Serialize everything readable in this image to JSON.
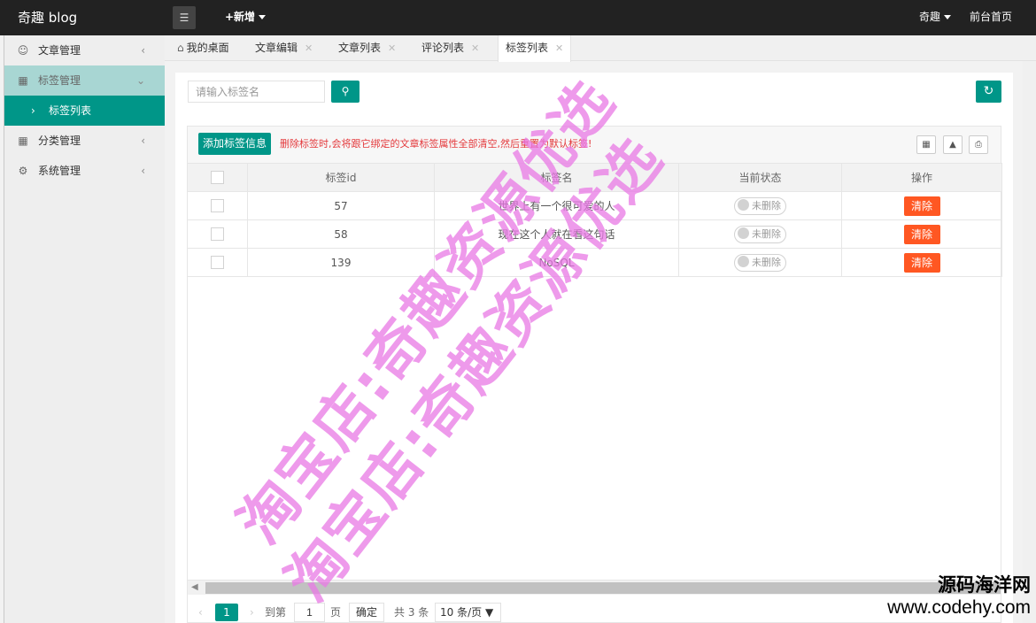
{
  "topbar": {
    "logo": "奇趣 blog",
    "menu_icon": "hamburger-icon",
    "add_new": "+新增",
    "user": "奇趣",
    "front_home": "前台首页"
  },
  "sidebar": {
    "items": [
      {
        "label": "文章管理",
        "icon": "user-icon"
      },
      {
        "label": "标签管理",
        "icon": "tag-icon"
      },
      {
        "label": "标签列表",
        "icon": "chevron-right-icon"
      },
      {
        "label": "分类管理",
        "icon": "folder-icon"
      },
      {
        "label": "系统管理",
        "icon": "settings-icon"
      }
    ]
  },
  "tabs": [
    {
      "label": "我的桌面"
    },
    {
      "label": "文章编辑"
    },
    {
      "label": "文章列表"
    },
    {
      "label": "评论列表"
    },
    {
      "label": "标签列表"
    }
  ],
  "search": {
    "placeholder": "请输入标签名"
  },
  "toolbar": {
    "add_label": "添加标签信息",
    "warning": "删除标签时,会将跟它绑定的文章标签属性全部清空,然后重置为默认标签!"
  },
  "table": {
    "headers": [
      "标签id",
      "标签名",
      "当前状态",
      "操作"
    ],
    "rows": [
      {
        "id": "57",
        "name": "世界上有一个很可爱的人",
        "status": "未删除",
        "action": "清除"
      },
      {
        "id": "58",
        "name": "现在这个人就在看这句话",
        "status": "未删除",
        "action": "清除"
      },
      {
        "id": "139",
        "name": "NoSQL",
        "status": "未删除",
        "action": "清除"
      }
    ]
  },
  "pager": {
    "current_page": "1",
    "goto_label": "到第",
    "page_input": "1",
    "page_unit": "页",
    "confirm": "确定",
    "total": "共 3 条",
    "page_size": "10 条/页"
  },
  "watermarks": {
    "line1": "淘宝店:奇趣资源优选",
    "line2": "淘宝店:奇趣资源优选",
    "brand_cn": "源码海洋网",
    "brand_url": "www.codehy.com"
  },
  "colors": {
    "accent": "#009688",
    "danger": "#ff5722",
    "warning_text": "#e4393c",
    "topbar": "#222222"
  }
}
